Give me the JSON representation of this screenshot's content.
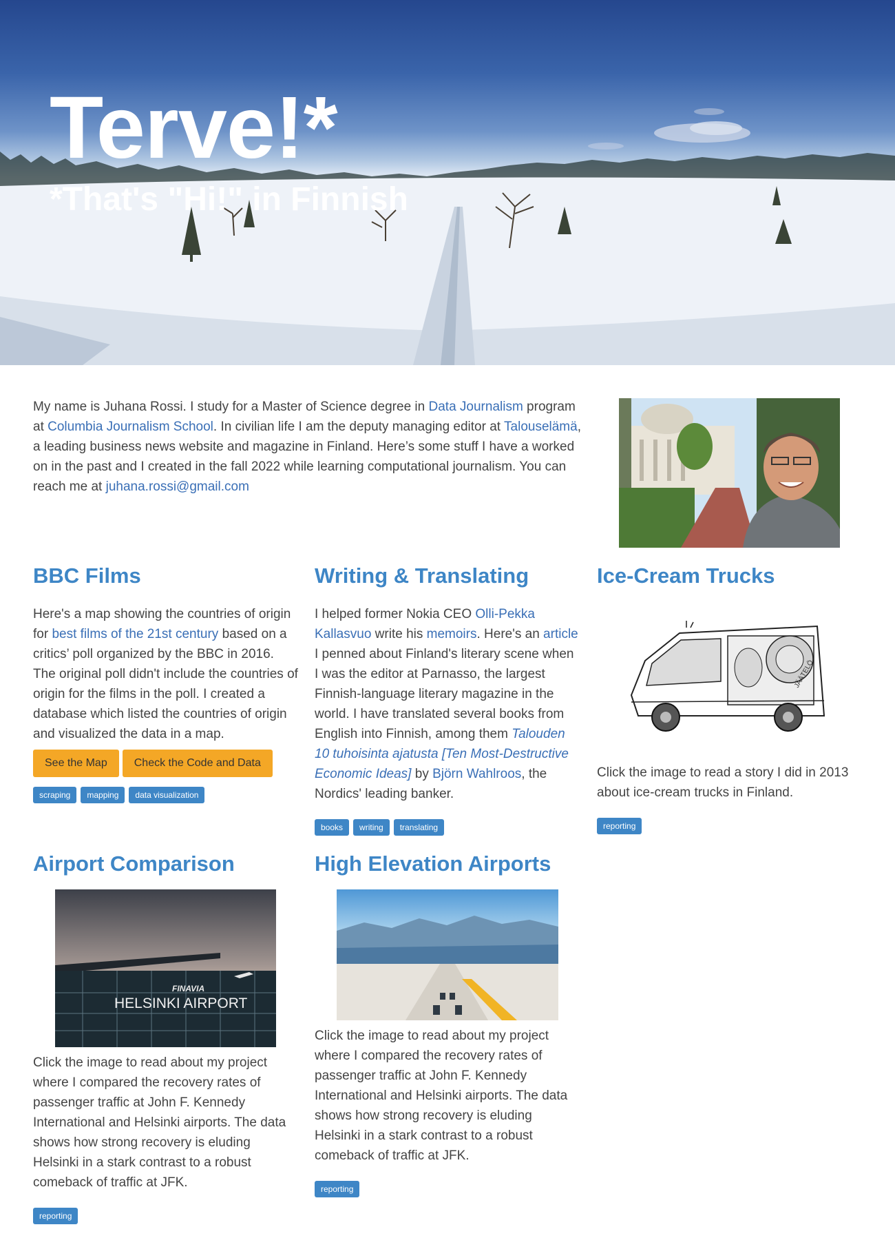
{
  "hero": {
    "title": "Terve!*",
    "subtitle": "*That's \"Hi!\" in Finnish"
  },
  "intro": {
    "t1": "My name is Juhana Rossi. I study for a Master of Science degree in ",
    "link_dj": "Data Journalism",
    "t2": " program at ",
    "link_cjs": "Columbia Journalism School",
    "t3": ". In civilian life I am the deputy managing editor at ",
    "link_te": "Talouselämä",
    "t4": ", a leading business news website and magazine in Finland. Here’s some stuff I have a worked on in the past and I created in the fall 2022 while learning computational journalism. You can reach me at ",
    "link_email": "juhana.rossi@gmail.com"
  },
  "bbc": {
    "heading": "BBC Films",
    "t1": "Here's a map showing the countries of origin for ",
    "link": "best films of the 21st century",
    "t2": " based on a critics’ poll organized by the BBC in 2016. The original poll didn't include the countries of origin for the films in the poll. I created a database which listed the countries of origin and visualized the data in a map.",
    "btn_map": "See the Map",
    "btn_code": "Check the Code and Data",
    "tags": [
      "scraping",
      "mapping",
      "data visualization"
    ]
  },
  "writing": {
    "heading": "Writing & Translating",
    "t1": "I helped former Nokia CEO ",
    "link_ceo": "Olli-Pekka Kallasvuo",
    "t2": " write his ",
    "link_mem": "memoirs",
    "t3": ". Here's an ",
    "link_art": "article",
    "t4": " I penned about Finland's literary scene when I was the editor at Parnasso, the largest Finnish-language literary magazine in the world. I have translated several books from English into Finnish, among them ",
    "link_book": "Talouden 10 tuhoisinta ajatusta [Ten Most-Destructive Economic Ideas]",
    "t5": " by ",
    "link_bw": "Björn Wahlroos",
    "t6": ", the Nordics' leading banker.",
    "tags": [
      "books",
      "writing",
      "translating"
    ]
  },
  "icecream": {
    "heading": "Ice-Cream Trucks",
    "text": "Click the image to read a story I did in 2013 about ice-cream trucks in Finland.",
    "tags": [
      "reporting"
    ]
  },
  "airport": {
    "heading": "Airport Comparison",
    "text": "Click the image to read about my project where I compared the recovery rates of passenger traffic at John F. Kennedy International and Helsinki airports. The data shows how strong recovery is eluding Helsinki in a stark contrast to a robust comeback of traffic at JFK.",
    "sign_brand": "FINAVIA",
    "sign_name": "HELSINKI AIRPORT",
    "tags": [
      "reporting"
    ]
  },
  "elevation": {
    "heading": "High Elevation Airports",
    "text": "Click the image to read about my project where I compared the recovery rates of passenger traffic at John F. Kennedy International and Helsinki airports. The data shows how strong recovery is eluding Helsinki in a stark contrast to a robust comeback of traffic at JFK.",
    "tags": [
      "reporting"
    ]
  },
  "truck_sign": "JÄÄTELÖ"
}
